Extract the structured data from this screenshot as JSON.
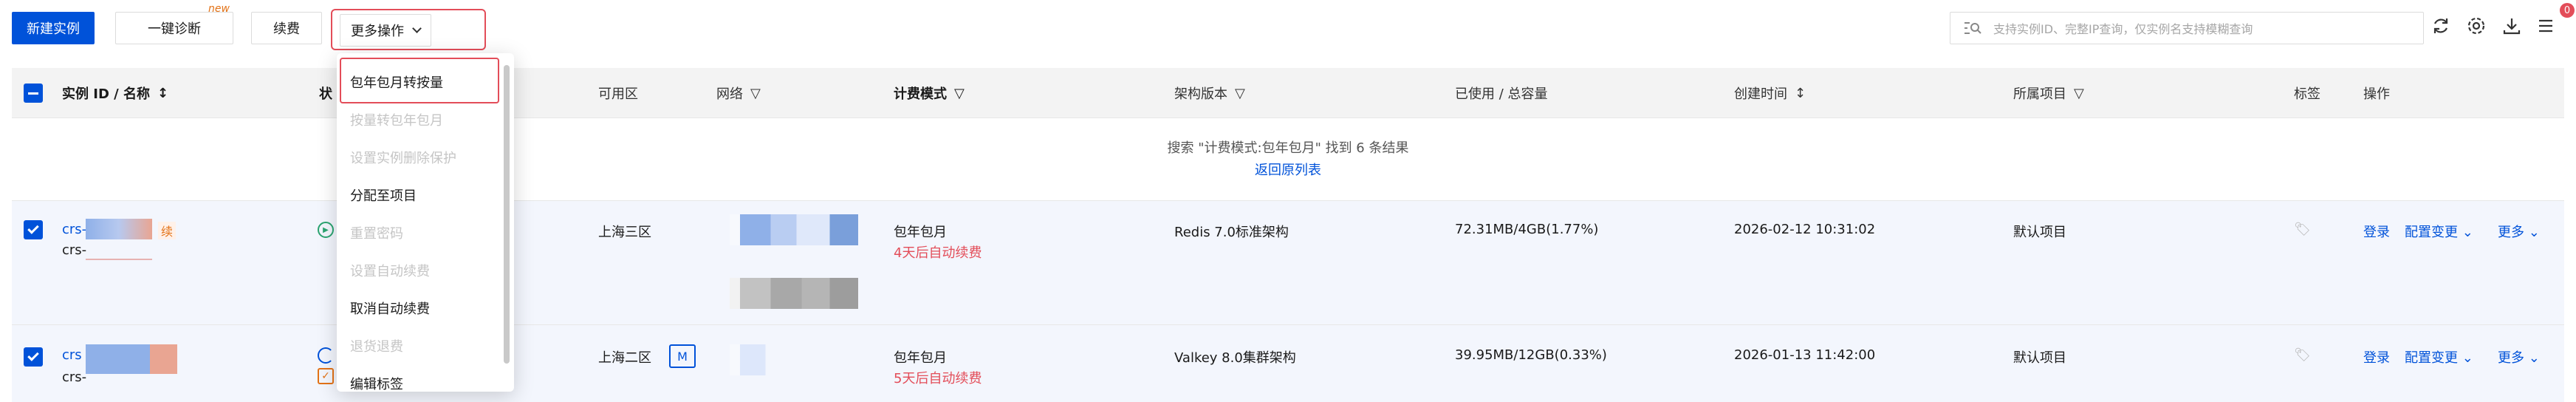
{
  "toolbar": {
    "create_label": "新建实例",
    "diagnose_label": "一键诊断",
    "new_badge": "new",
    "renew_label": "续费",
    "more_label": "更多操作",
    "search_placeholder": "支持实例ID、完整IP查询，仅实例名支持模糊查询",
    "notification_count": "0",
    "icons": [
      "refresh-icon",
      "settings-icon",
      "download-icon",
      "list-icon"
    ]
  },
  "table": {
    "headers": {
      "instance": "实例 ID / 名称",
      "status": "状",
      "zone": "可用区",
      "network": "网络",
      "billing": "计费模式",
      "arch": "架构版本",
      "usage": "已使用 / 总容量",
      "created": "创建时间",
      "project": "所属项目",
      "tags": "标签",
      "ops": "操作"
    },
    "summary": "搜索 \"计费模式:包年包月\" 找到 6 条结果",
    "back_link": "返回原列表",
    "rows": [
      {
        "id": "crs-",
        "name": "crs-",
        "renew_tag": "续",
        "zone": "上海三区",
        "billing": "包年包月",
        "renew_hint": "4天后自动续费",
        "arch": "Redis 7.0标准架构",
        "usage": "72.31MB/4GB(1.77%)",
        "created": "2026-02-12 10:31:02",
        "project": "默认项目",
        "op_login": "登录",
        "op_config": "配置变更",
        "op_more": "更多"
      },
      {
        "id": "crs",
        "name": "crs-",
        "zone": "上海二区",
        "zone_badge": "M",
        "billing": "包年包月",
        "renew_hint": "5天后自动续费",
        "arch": "Valkey 8.0集群架构",
        "usage": "39.95MB/12GB(0.33%)",
        "created": "2026-01-13 11:42:00",
        "project": "默认项目",
        "op_login": "登录",
        "op_config": "配置变更",
        "op_more": "更多"
      }
    ]
  },
  "dropdown": {
    "items": [
      {
        "label": "包年包月转按量",
        "disabled": false
      },
      {
        "label": "按量转包年包月",
        "disabled": true
      },
      {
        "label": "设置实例删除保护",
        "disabled": true
      },
      {
        "label": "分配至项目",
        "disabled": false
      },
      {
        "label": "重置密码",
        "disabled": true
      },
      {
        "label": "设置自动续费",
        "disabled": true
      },
      {
        "label": "取消自动续费",
        "disabled": false
      },
      {
        "label": "退货退费",
        "disabled": true
      },
      {
        "label": "编辑标签",
        "disabled": false
      }
    ]
  },
  "colors": {
    "primary": "#0052d9",
    "danger": "#e34d59",
    "warning": "#e37318",
    "success": "#2ba471"
  }
}
